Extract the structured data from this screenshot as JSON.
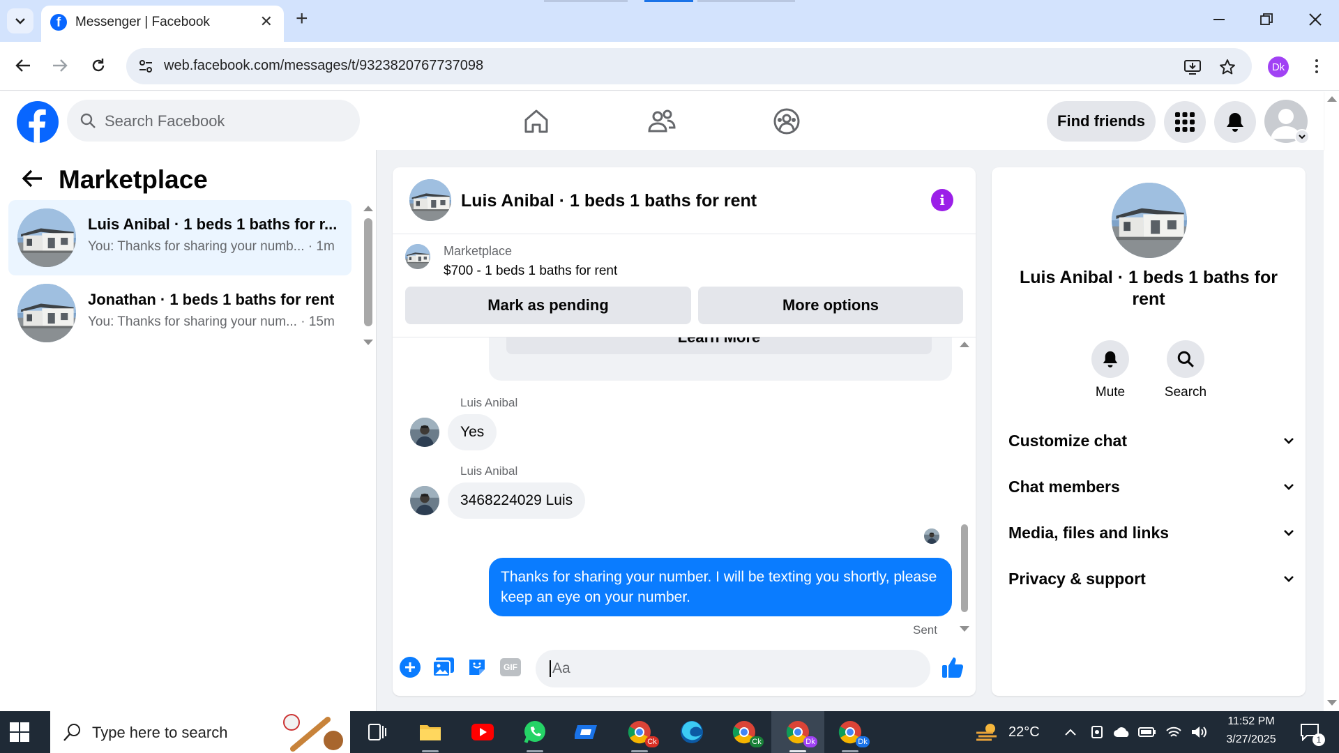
{
  "browser": {
    "tab_title": "Messenger | Facebook",
    "new_tab": "+",
    "close_tab": "✕",
    "url": "web.facebook.com/messages/t/9323820767737098",
    "profile_initials": "Dk"
  },
  "header": {
    "search_placeholder": "Search Facebook",
    "find_friends": "Find friends"
  },
  "left_panel": {
    "title": "Marketplace",
    "conversations": [
      {
        "name": "Luis Anibal · 1 beds 1 baths for r...",
        "snippet": "You: Thanks for sharing your numb...",
        "time": "1m",
        "active": true
      },
      {
        "name": "Jonathan · 1 beds 1 baths for rent",
        "snippet": "You: Thanks for sharing your num...",
        "time": "15m",
        "active": false
      }
    ]
  },
  "chat": {
    "title": "Luis Anibal · 1 beds 1 baths for rent",
    "marketplace_label": "Marketplace",
    "listing": "$700 - 1 beds 1 baths for rent",
    "mark_pending": "Mark as pending",
    "more_options": "More options",
    "learn_more": "Learn More",
    "messages": [
      {
        "sender": "Luis Anibal",
        "text": "Yes"
      },
      {
        "sender": "Luis Anibal",
        "text": "3468224029 Luis"
      }
    ],
    "outgoing": "Thanks for sharing your number. I will be texting you shortly, please keep an eye on your number.",
    "status": "Sent",
    "composer_placeholder": "Aa",
    "gif_label": "GIF"
  },
  "right_panel": {
    "name": "Luis Anibal · 1 beds 1 baths for rent",
    "mute": "Mute",
    "search": "Search",
    "sections": [
      "Customize chat",
      "Chat members",
      "Media, files and links",
      "Privacy & support"
    ]
  },
  "taskbar": {
    "search_placeholder": "Type here to search",
    "weather": "22°C",
    "time": "11:52 PM",
    "date": "3/27/2025",
    "notifications": "1",
    "ck_badge": "Ck",
    "dk_badge": "Dk"
  },
  "colors": {
    "facebook_blue": "#0866ff",
    "messenger_blue": "#0a7cff",
    "info_purple": "#9b1fe8",
    "active_conversation": "#ebf5ff"
  }
}
